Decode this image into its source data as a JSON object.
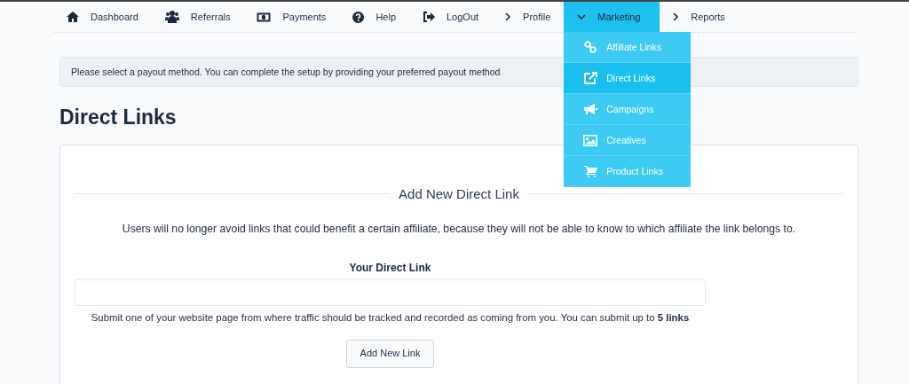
{
  "nav": {
    "items": [
      {
        "label": "Dashboard",
        "selected": false
      },
      {
        "label": "Referrals",
        "selected": false
      },
      {
        "label": "Payments",
        "selected": false
      },
      {
        "label": "Help",
        "selected": false
      },
      {
        "label": "LogOut",
        "selected": false
      },
      {
        "label": "Profile",
        "selected": false
      },
      {
        "label": "Marketing",
        "selected": true,
        "expanded": true,
        "children": [
          {
            "label": "Affiliate Links",
            "selected": false
          },
          {
            "label": "Direct Links",
            "selected": true
          },
          {
            "label": "Campaigns",
            "selected": false
          },
          {
            "label": "Creatives",
            "selected": false
          },
          {
            "label": "Product Links",
            "selected": false
          }
        ]
      },
      {
        "label": "Reports",
        "selected": false
      }
    ]
  },
  "alert": {
    "text": "Please select a payout method. You can complete the setup by providing your preferred payout method"
  },
  "page_title": "Direct Links",
  "form": {
    "legend": "Add New Direct Link",
    "description": "Users will no longer avoid links that could benefit a certain affiliate, because they will not be able to know to which affiliate the link belongs to.",
    "field_label": "Your Direct Link",
    "help": "Submit one of your website page from where traffic should be tracked and recorded as coming from you. You can submit up to **5 links**",
    "button": "Add New Link"
  }
}
